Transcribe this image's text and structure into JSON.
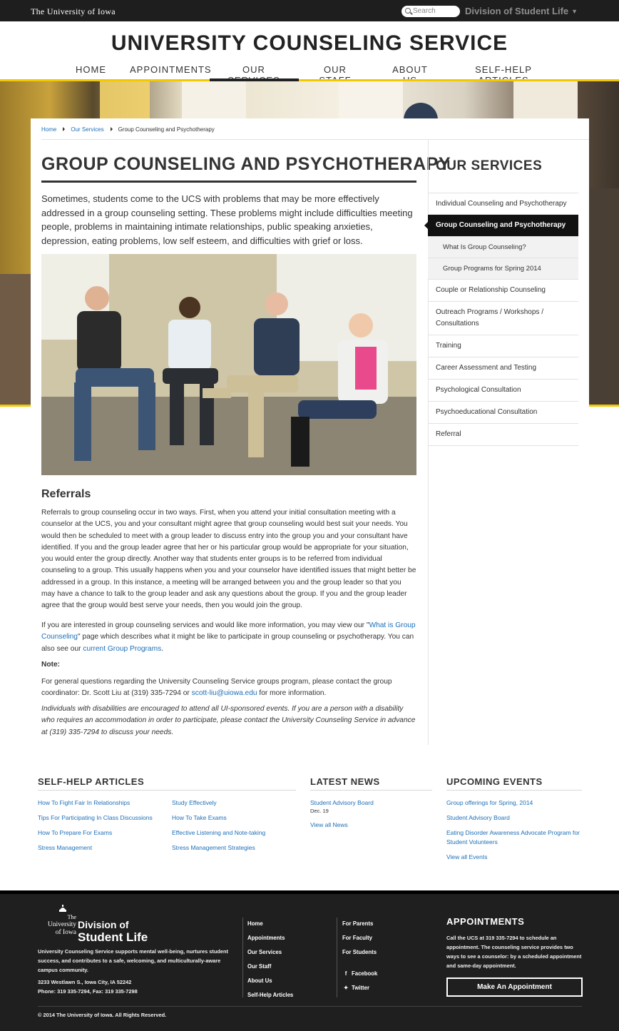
{
  "topbar": {
    "logo_text": "The University of Iowa",
    "search_placeholder": "Search",
    "division_label": "Division of Student Life"
  },
  "header": {
    "site_title": "UNIVERSITY COUNSELING SERVICE",
    "nav": [
      "HOME",
      "APPOINTMENTS",
      "OUR SERVICES",
      "OUR STAFF",
      "ABOUT US",
      "SELF-HELP ARTICLES"
    ],
    "active_nav": "OUR SERVICES"
  },
  "breadcrumb": [
    "Home",
    "Our Services",
    "Group Counseling and Psychotherapy"
  ],
  "main": {
    "title": "GROUP COUNSELING AND PSYCHOTHERAPY",
    "intro": "Sometimes, students come to the UCS with problems that may be more effectively addressed in a group counseling setting. These problems might include difficulties meeting people, problems in maintaining intimate relationships, public speaking anxieties, depression, eating problems, low self esteem, and difficulties with grief or loss.",
    "referrals_heading": "Referrals",
    "referrals_p1": "Referrals to group counseling occur in two ways. First, when you attend your initial consultation meeting with a counselor at the UCS, you and your consultant might agree that group counseling would best suit your needs. You would then be scheduled to meet with a group leader to discuss entry into the group you and your consultant have identified. If you and the group leader agree that her or his particular group would be appropriate for your situation, you would enter the group directly. Another way that students enter groups is to be referred from individual counseling to a group. This usually happens when you and your counselor have identified issues that might better be addressed in a group. In this instance, a meeting will be arranged between you and the group leader so that you may have a chance to talk to the group leader and ask any questions about the group. If you and the group leader agree that the group would best serve your needs, then you would join the group.",
    "more_info_pre": "If you are interested in group counseling services and would like more information, you may view our \"",
    "more_info_link1": "What is Group Counseling",
    "more_info_mid": "\" page which describes what it might be like to participate in group counseling or psychotherapy. You can also see our ",
    "more_info_link2": "current Group Programs",
    "more_info_end": ".",
    "note_label": "Note:",
    "contact_pre": "For general questions regarding the University Counseling Service groups program, please contact the group coordinator: Dr. Scott Liu at (319) 335-7294 or ",
    "contact_email": "scott-liu@uiowa.edu",
    "contact_post": " for more information.",
    "disability_note": "Individuals with disabilities are encouraged to attend all UI-sponsored events.  If you are a person with a disability who requires an accommodation in order to participate, please contact the University Counseling Service in advance at (319) 335-7294 to discuss your needs."
  },
  "sidebar": {
    "title": "OUR SERVICES",
    "items": [
      {
        "label": "Individual Counseling and Psychotherapy",
        "type": "normal"
      },
      {
        "label": "Group Counseling and Psychotherapy",
        "type": "active"
      },
      {
        "label": "What Is Group Counseling?",
        "type": "sub"
      },
      {
        "label": "Group Programs for Spring 2014",
        "type": "sub"
      },
      {
        "label": "Couple or Relationship Counseling",
        "type": "normal"
      },
      {
        "label": "Outreach Programs / Workshops / Consultations",
        "type": "normal"
      },
      {
        "label": "Training",
        "type": "normal"
      },
      {
        "label": "Career Assessment and Testing",
        "type": "normal"
      },
      {
        "label": "Psychological Consultation",
        "type": "normal"
      },
      {
        "label": "Psychoeducational Consultation",
        "type": "normal"
      },
      {
        "label": "Referral",
        "type": "normal"
      }
    ]
  },
  "widgets": {
    "selfhelp_title": "SELF-HELP ARTICLES",
    "selfhelp_col1": [
      "How To Fight Fair In Relationships",
      "Tips For Participating In Class Discussions",
      "How To Prepare For Exams",
      "Stress Management"
    ],
    "selfhelp_col2": [
      "Study Effectively",
      "How To Take Exams",
      "Effective Listening and Note-taking",
      "Stress Management Strategies"
    ],
    "news_title": "LATEST NEWS",
    "news_item": "Student Advisory Board",
    "news_date": "Dec. 19",
    "news_all": "View all News",
    "events_title": "UPCOMING EVENTS",
    "events": [
      "Group offerings for Spring, 2014",
      "Student Advisory Board",
      "Eating Disorder Awareness Advocate Program for Student Volunteers"
    ],
    "events_all": "View all Events"
  },
  "footer": {
    "logo_univ_line1": "The",
    "logo_univ_line2": "University",
    "logo_univ_line3": "of Iowa",
    "logo_div_line1": "Division of",
    "logo_div_line2": "Student Life",
    "description": "University Counseling Service supports mental well-being, nurtures student success, and contributes to a safe, welcoming, and multiculturally-aware campus community.",
    "address": "3233 Westlawn S., Iowa City, IA 52242",
    "phone": "Phone: 319 335-7294, Fax: 319 335-7298",
    "links_col1": [
      "Home",
      "Appointments",
      "Our Services",
      "Our Staff",
      "About Us",
      "Self-Help Articles"
    ],
    "links_col2": [
      "For Parents",
      "For Faculty",
      "For Students"
    ],
    "facebook": "Facebook",
    "twitter": "Twitter",
    "appt_title": "APPOINTMENTS",
    "appt_text": "Call the UCS at 319 335-7294 to schedule an appointment. The counseling service provides two ways to see a counselor: by a scheduled appointment and same-day appointment.",
    "appt_button": "Make An Appointment",
    "copyright": "© 2014 The University of Iowa. All Rights Reserved."
  },
  "colors": {
    "gold": "#f2c800",
    "dark": "#1f1f1f",
    "link": "#1d6fb8"
  }
}
